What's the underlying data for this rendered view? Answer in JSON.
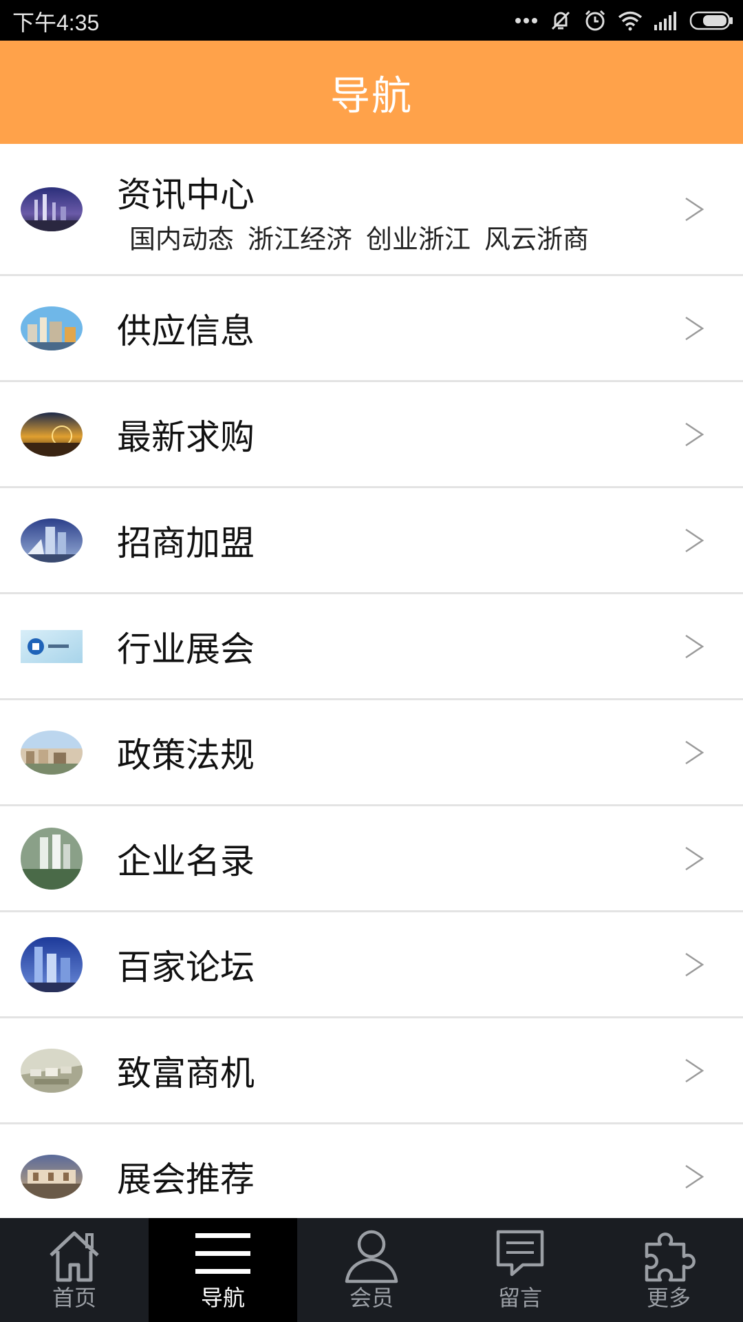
{
  "status_bar": {
    "time": "下午4:35",
    "icons": [
      "more-dots-icon",
      "vibrate-off-icon",
      "alarm-icon",
      "wifi-icon",
      "signal-icon",
      "battery-icon"
    ]
  },
  "header": {
    "title": "导航"
  },
  "nav_list": [
    {
      "label": "资讯中心",
      "sublinks": [
        "国内动态",
        "浙江经济",
        "创业浙江",
        "风云浙商"
      ]
    },
    {
      "label": "供应信息"
    },
    {
      "label": "最新求购"
    },
    {
      "label": "招商加盟"
    },
    {
      "label": "行业展会"
    },
    {
      "label": "政策法规"
    },
    {
      "label": "企业名录"
    },
    {
      "label": "百家论坛"
    },
    {
      "label": "致富商机"
    },
    {
      "label": "展会推荐"
    }
  ],
  "chevron": ">",
  "tabs": [
    {
      "label": "首页",
      "icon": "home-icon",
      "active": false
    },
    {
      "label": "导航",
      "icon": "menu-icon",
      "active": true
    },
    {
      "label": "会员",
      "icon": "user-icon",
      "active": false
    },
    {
      "label": "留言",
      "icon": "message-icon",
      "active": false
    },
    {
      "label": "更多",
      "icon": "puzzle-icon",
      "active": false
    }
  ],
  "colors": {
    "header_bg": "#ffa24a",
    "status_bg": "#000000",
    "tabbar_bg": "#1a1d22",
    "tab_active_bg": "#000000"
  }
}
